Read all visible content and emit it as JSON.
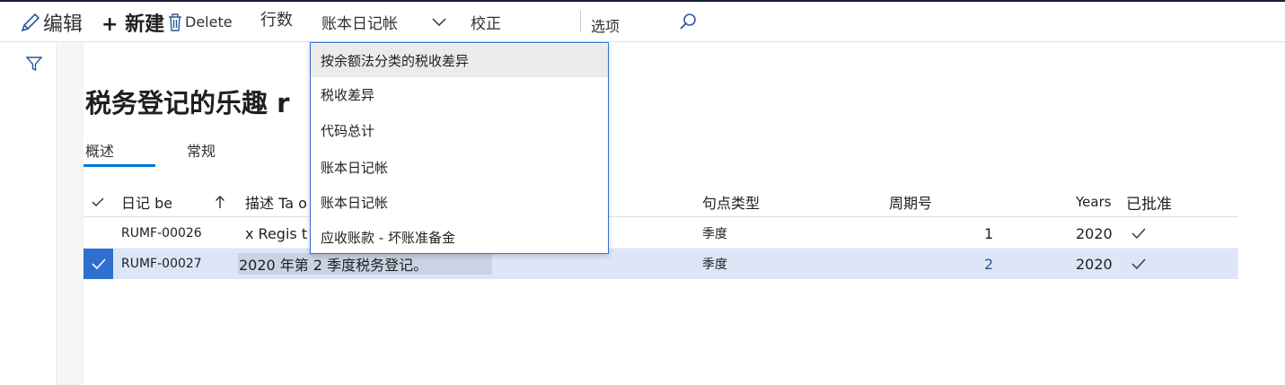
{
  "toolbar": {
    "edit_label": "编辑",
    "new_label": "+ 新建",
    "delete_label": "Delete",
    "lines_label": "行数",
    "journal_label": "账本日记帐",
    "verify_label": "校正",
    "options_label": "选项",
    "icons": [
      "pencil-icon",
      "trash-icon",
      "chevron-down-icon",
      "search-icon"
    ]
  },
  "sidebar": {
    "icon": "filter-icon"
  },
  "page": {
    "title": "税务登记的乐趣 r",
    "tabs": [
      {
        "label": "概述",
        "selected": true
      },
      {
        "label": "常规",
        "selected": false
      }
    ]
  },
  "grid": {
    "columns": [
      "日记 be",
      "描述 Ta o",
      "句点类型",
      "周期号",
      "Years",
      "已批准"
    ],
    "sort_icon": "arrow-up-icon",
    "rows": [
      {
        "journal": "RUMF-00026",
        "description": "x Regis t",
        "period_type": "季度",
        "period_number": "1",
        "year": "2020",
        "approved": true,
        "selected": false
      },
      {
        "journal": "RUMF-00027",
        "description": "2020 年第 2 季度税务登记。",
        "period_type": "季度",
        "period_number": "2",
        "year": "2020",
        "approved": true,
        "selected": true
      }
    ]
  },
  "dropdown": {
    "items": [
      "按余额法分类的税收差异",
      "税收差异",
      "代码总计",
      "账本日记帐",
      "账本日记帐",
      "应收账款 - 坏账准备金"
    ],
    "highlighted_index": 0
  },
  "colors": {
    "accent": "#0078d4",
    "selected_row": "#dce6f7",
    "row_checkbox": "#2f6fcf",
    "dropdown_border": "#2f6fcf"
  }
}
